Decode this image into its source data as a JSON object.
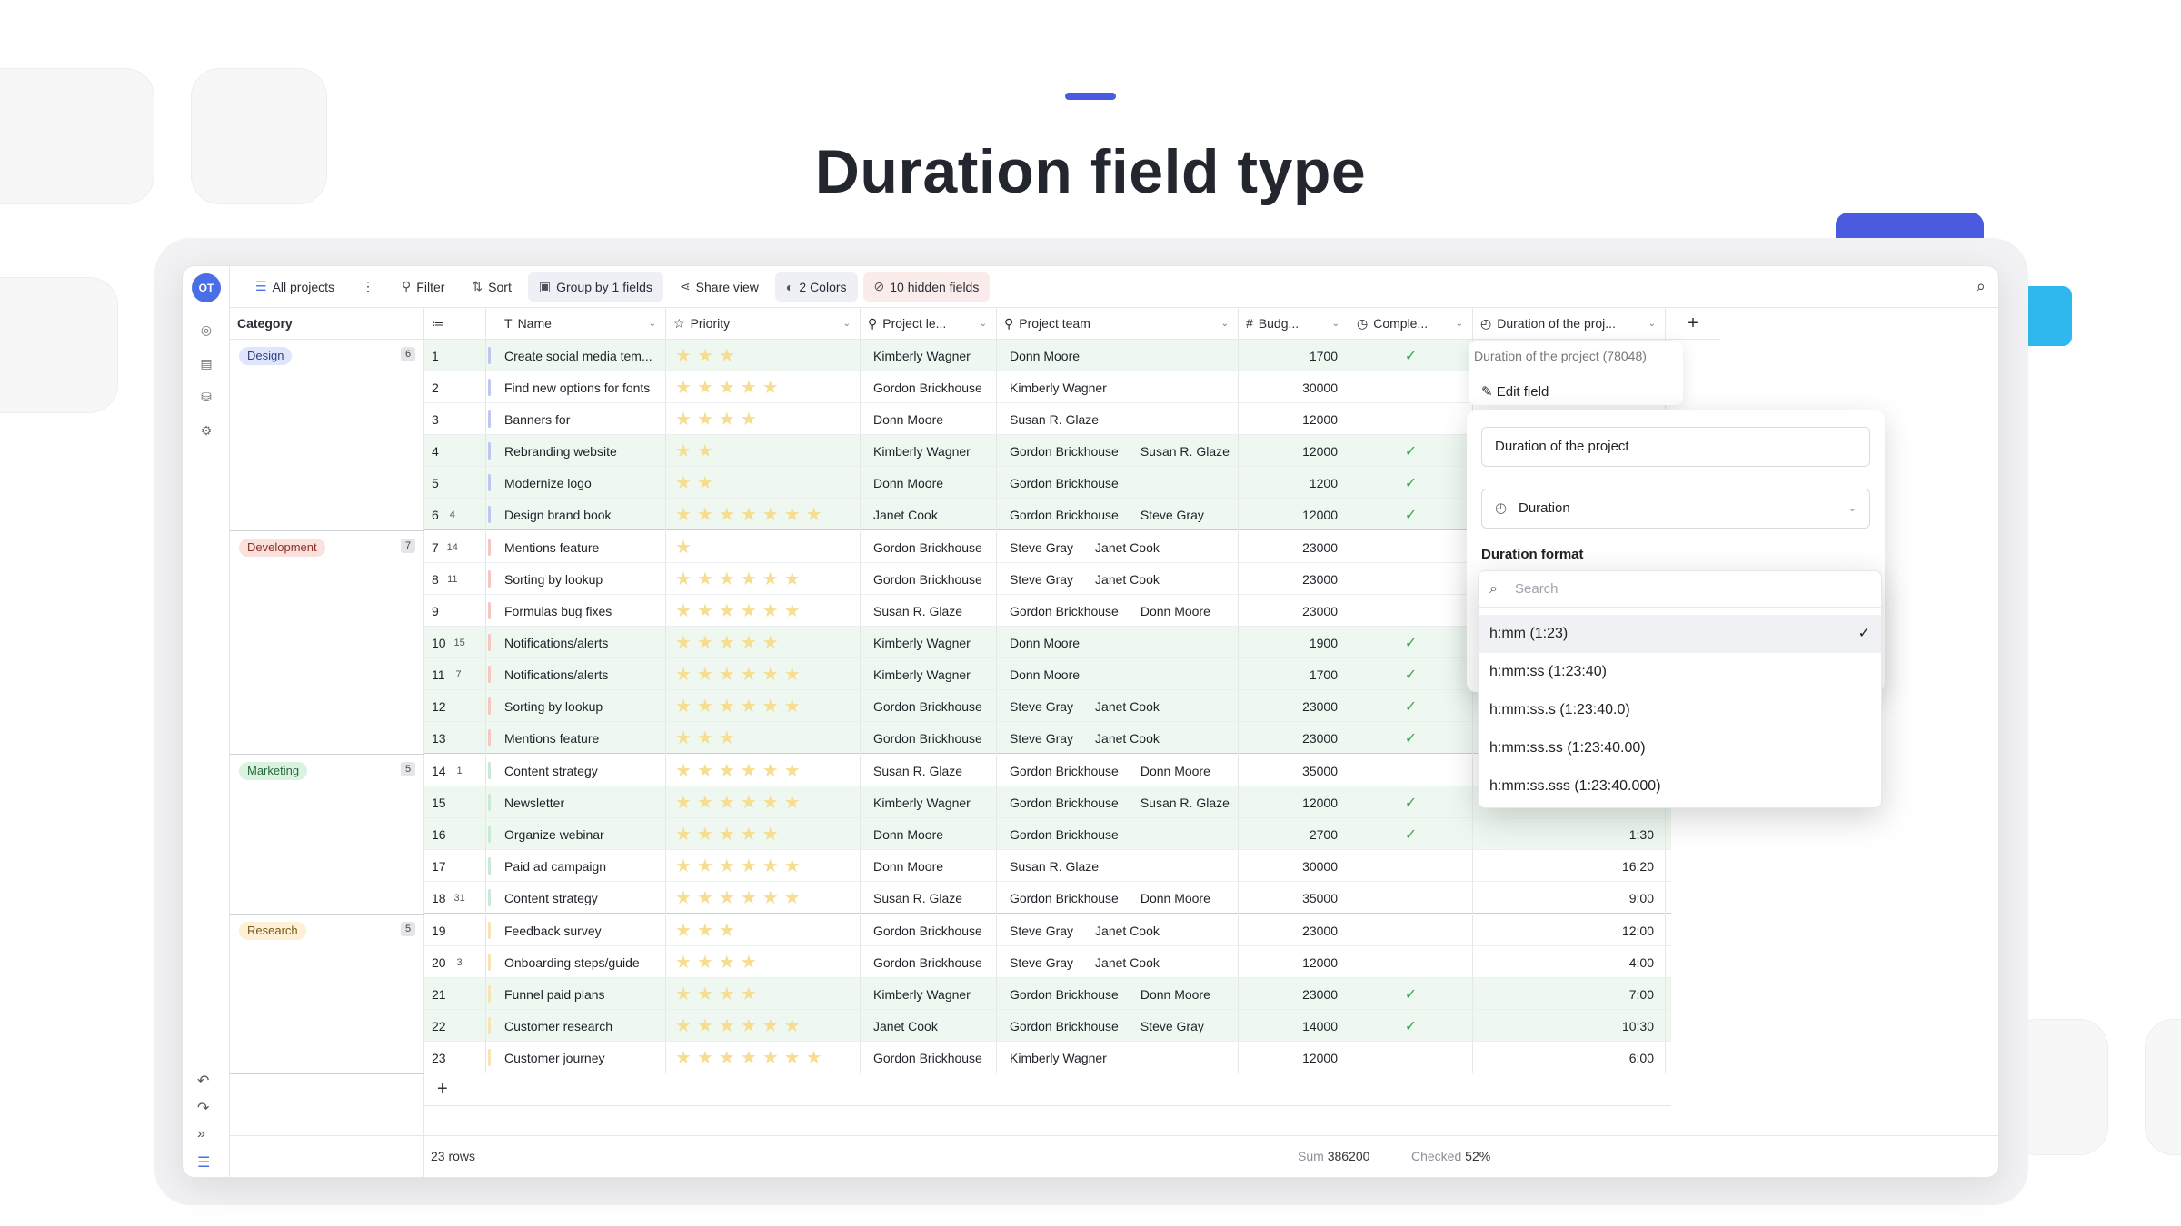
{
  "headline": "Duration field type",
  "colors": {
    "accent": "#4a5be0",
    "cyan": "#2fb8ee",
    "check": "#3aa55d",
    "row_highlight": "#eef8f0",
    "star": "#f6dd8f"
  },
  "avatar": "OT",
  "toolbar": {
    "view": "All projects",
    "filter": "Filter",
    "sort": "Sort",
    "group": "Group by 1 fields",
    "share": "Share view",
    "colors": "2 Colors",
    "hidden": "10 hidden fields"
  },
  "columns": {
    "category": "Category",
    "name": "Name",
    "priority": "Priority",
    "lead": "Project le...",
    "team": "Project team",
    "budget": "Budg...",
    "complete": "Comple...",
    "duration": "Duration of the proj..."
  },
  "groups": [
    {
      "label": "Design",
      "count": "6",
      "bg": "#dfe6fb",
      "color": "#2f3e82"
    },
    {
      "label": "Development",
      "count": "7",
      "bg": "#fbe1de",
      "color": "#8a2f25"
    },
    {
      "label": "Marketing",
      "count": "5",
      "bg": "#dcf2e1",
      "color": "#25663a"
    },
    {
      "label": "Research",
      "count": "5",
      "bg": "#fdf0d6",
      "color": "#7a5a18"
    }
  ],
  "rows": [
    {
      "num": "1",
      "cnt": "",
      "name": "Create social media tem...",
      "stars": 3,
      "lead": "Kimberly Wagner",
      "team": [
        "Donn Moore"
      ],
      "budget": "1700",
      "done": true,
      "dur": "",
      "green": true,
      "bar": "#bcc8f3"
    },
    {
      "num": "2",
      "cnt": "",
      "name": "Find new options for fonts",
      "stars": 5,
      "lead": "Gordon Brickhouse",
      "team": [
        "Kimberly Wagner"
      ],
      "budget": "30000",
      "done": false,
      "dur": "",
      "green": false,
      "bar": "#bcc8f3"
    },
    {
      "num": "3",
      "cnt": "",
      "name": "Banners for",
      "stars": 4,
      "lead": "Donn Moore",
      "team": [
        "Susan R. Glaze"
      ],
      "budget": "12000",
      "done": false,
      "dur": "",
      "green": false,
      "bar": "#bcc8f3"
    },
    {
      "num": "4",
      "cnt": "",
      "name": "Rebranding website",
      "stars": 2,
      "lead": "Kimberly Wagner",
      "team": [
        "Gordon Brickhouse",
        "Susan R. Glaze"
      ],
      "budget": "12000",
      "done": true,
      "dur": "",
      "green": true,
      "bar": "#bcc8f3"
    },
    {
      "num": "5",
      "cnt": "",
      "name": "Modernize logo",
      "stars": 2,
      "lead": "Donn Moore",
      "team": [
        "Gordon Brickhouse"
      ],
      "budget": "1200",
      "done": true,
      "dur": "",
      "green": true,
      "bar": "#bcc8f3"
    },
    {
      "num": "6",
      "cnt": "4",
      "name": "Design brand book",
      "stars": 7,
      "lead": "Janet Cook",
      "team": [
        "Gordon Brickhouse",
        "Steve Gray"
      ],
      "budget": "12000",
      "done": true,
      "dur": "",
      "green": true,
      "bar": "#bcc8f3"
    },
    {
      "num": "7",
      "cnt": "14",
      "name": "Mentions feature",
      "stars": 1,
      "lead": "Gordon Brickhouse",
      "team": [
        "Steve Gray",
        "Janet Cook"
      ],
      "budget": "23000",
      "done": false,
      "dur": "",
      "green": false,
      "bar": "#f4c7c1"
    },
    {
      "num": "8",
      "cnt": "11",
      "name": "Sorting by lookup",
      "stars": 6,
      "lead": "Gordon Brickhouse",
      "team": [
        "Steve Gray",
        "Janet Cook"
      ],
      "budget": "23000",
      "done": false,
      "dur": "",
      "green": false,
      "bar": "#f4c7c1"
    },
    {
      "num": "9",
      "cnt": "",
      "name": "Formulas bug fixes",
      "stars": 6,
      "lead": "Susan R. Glaze",
      "team": [
        "Gordon Brickhouse",
        "Donn Moore"
      ],
      "budget": "23000",
      "done": false,
      "dur": "",
      "green": false,
      "bar": "#f4c7c1"
    },
    {
      "num": "10",
      "cnt": "15",
      "name": "Notifications/alerts",
      "stars": 5,
      "lead": "Kimberly Wagner",
      "team": [
        "Donn Moore"
      ],
      "budget": "1900",
      "done": true,
      "dur": "",
      "green": true,
      "bar": "#f4c7c1"
    },
    {
      "num": "11",
      "cnt": "7",
      "name": "Notifications/alerts",
      "stars": 6,
      "lead": "Kimberly Wagner",
      "team": [
        "Donn Moore"
      ],
      "budget": "1700",
      "done": true,
      "dur": "",
      "green": true,
      "bar": "#f4c7c1"
    },
    {
      "num": "12",
      "cnt": "",
      "name": "Sorting by lookup",
      "stars": 6,
      "lead": "Gordon Brickhouse",
      "team": [
        "Steve Gray",
        "Janet Cook"
      ],
      "budget": "23000",
      "done": true,
      "dur": "",
      "green": true,
      "bar": "#f4c7c1"
    },
    {
      "num": "13",
      "cnt": "",
      "name": "Mentions feature",
      "stars": 3,
      "lead": "Gordon Brickhouse",
      "team": [
        "Steve Gray",
        "Janet Cook"
      ],
      "budget": "23000",
      "done": true,
      "dur": "",
      "green": true,
      "bar": "#f4c7c1"
    },
    {
      "num": "14",
      "cnt": "1",
      "name": "Content strategy",
      "stars": 6,
      "lead": "Susan R. Glaze",
      "team": [
        "Gordon Brickhouse",
        "Donn Moore"
      ],
      "budget": "35000",
      "done": false,
      "dur": "",
      "green": false,
      "bar": "#c9ead2"
    },
    {
      "num": "15",
      "cnt": "",
      "name": "Newsletter",
      "stars": 6,
      "lead": "Kimberly Wagner",
      "team": [
        "Gordon Brickhouse",
        "Susan R. Glaze"
      ],
      "budget": "12000",
      "done": true,
      "dur": "",
      "green": true,
      "bar": "#c9ead2"
    },
    {
      "num": "16",
      "cnt": "",
      "name": "Organize webinar",
      "stars": 5,
      "lead": "Donn Moore",
      "team": [
        "Gordon Brickhouse"
      ],
      "budget": "2700",
      "done": true,
      "dur": "1:30",
      "green": true,
      "bar": "#c9ead2"
    },
    {
      "num": "17",
      "cnt": "",
      "name": "Paid ad campaign",
      "stars": 6,
      "lead": "Donn Moore",
      "team": [
        "Susan R. Glaze"
      ],
      "budget": "30000",
      "done": false,
      "dur": "16:20",
      "green": false,
      "bar": "#c9ead2"
    },
    {
      "num": "18",
      "cnt": "31",
      "name": "Content strategy",
      "stars": 6,
      "lead": "Susan R. Glaze",
      "team": [
        "Gordon Brickhouse",
        "Donn Moore"
      ],
      "budget": "35000",
      "done": false,
      "dur": "9:00",
      "green": false,
      "bar": "#c9ead2"
    },
    {
      "num": "19",
      "cnt": "",
      "name": "Feedback survey",
      "stars": 3,
      "lead": "Gordon Brickhouse",
      "team": [
        "Steve Gray",
        "Janet Cook"
      ],
      "budget": "23000",
      "done": false,
      "dur": "12:00",
      "green": false,
      "bar": "#f7e3b6"
    },
    {
      "num": "20",
      "cnt": "3",
      "name": "Onboarding steps/guide",
      "stars": 4,
      "lead": "Gordon Brickhouse",
      "team": [
        "Steve Gray",
        "Janet Cook"
      ],
      "budget": "12000",
      "done": false,
      "dur": "4:00",
      "green": false,
      "bar": "#f7e3b6"
    },
    {
      "num": "21",
      "cnt": "",
      "name": "Funnel paid plans",
      "stars": 4,
      "lead": "Kimberly Wagner",
      "team": [
        "Gordon Brickhouse",
        "Donn Moore"
      ],
      "budget": "23000",
      "done": true,
      "dur": "7:00",
      "green": true,
      "bar": "#f7e3b6"
    },
    {
      "num": "22",
      "cnt": "",
      "name": "Customer research",
      "stars": 6,
      "lead": "Janet Cook",
      "team": [
        "Gordon Brickhouse",
        "Steve Gray"
      ],
      "budget": "14000",
      "done": true,
      "dur": "10:30",
      "green": true,
      "bar": "#f7e3b6"
    },
    {
      "num": "23",
      "cnt": "",
      "name": "Customer journey",
      "stars": 7,
      "lead": "Gordon Brickhouse",
      "team": [
        "Kimberly Wagner"
      ],
      "budget": "12000",
      "done": false,
      "dur": "6:00",
      "green": false,
      "bar": "#f7e3b6"
    }
  ],
  "footer": {
    "rows": "23 rows",
    "sum_label": "Sum",
    "sum_value": "386200",
    "checked_label": "Checked",
    "checked_value": "52%"
  },
  "field_popup": {
    "title": "Duration of the project (78048)",
    "edit": "Edit field"
  },
  "edit_panel": {
    "name_value": "Duration of the project",
    "type": "Duration",
    "format_label": "Duration format"
  },
  "dropdown": {
    "search_placeholder": "Search",
    "options": [
      "h:mm (1:23)",
      "h:mm:ss (1:23:40)",
      "h:mm:ss.s (1:23:40.0)",
      "h:mm:ss.ss (1:23:40.00)",
      "h:mm:ss.sss (1:23:40.000)"
    ],
    "selected": "h:mm (1:23)"
  },
  "icons": {
    "search": "search-icon",
    "filter": "filter-icon",
    "sort": "sort-icon",
    "share": "share-icon",
    "plus": "plus-icon",
    "check": "check-icon",
    "star": "star-icon"
  }
}
